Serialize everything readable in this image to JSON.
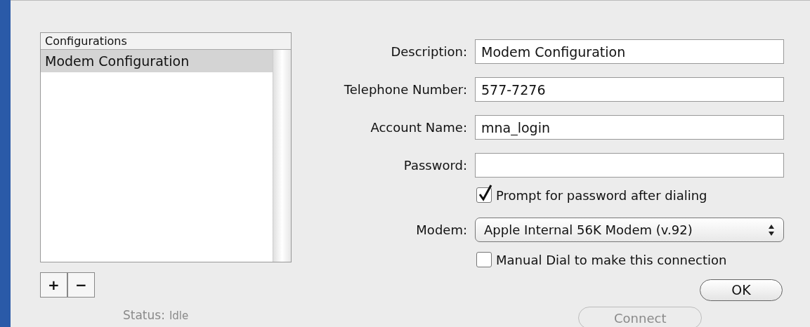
{
  "configurations": {
    "header": "Configurations",
    "items": [
      {
        "label": "Modem Configuration",
        "selected": true
      }
    ]
  },
  "list_buttons": [
    "+",
    "−"
  ],
  "fields": [
    {
      "label": "Description:",
      "value": "Modem Configuration"
    },
    {
      "label": "Telephone Number:",
      "value": "577-7276"
    },
    {
      "label": "Account Name:",
      "value": "mna_login"
    },
    {
      "label": "Password:"
    }
  ],
  "options": [
    {
      "kind": "checkbox",
      "label": "Prompt for password after dialing",
      "checked": true
    },
    {
      "kind": "popup",
      "label": "Modem:",
      "value": "Apple Internal 56K Modem (v.92)"
    },
    {
      "kind": "checkbox",
      "label": "Manual Dial to make this connection",
      "checked": false
    }
  ],
  "ok_button": "OK",
  "background_window": {
    "status_label": "Status:",
    "status_value": "Idle",
    "connect_button": "Connect"
  }
}
